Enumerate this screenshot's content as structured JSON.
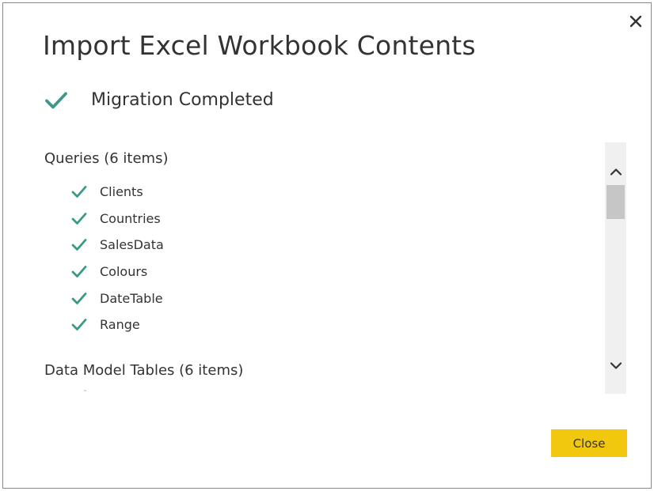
{
  "dialog": {
    "title": "Import Excel Workbook Contents",
    "close_icon": "close-icon",
    "status": {
      "icon": "check-icon",
      "text": "Migration Completed"
    }
  },
  "queries": {
    "heading": "Queries (6 items)",
    "items": [
      {
        "label": "Clients",
        "icon": "check-icon"
      },
      {
        "label": "Countries",
        "icon": "check-icon"
      },
      {
        "label": "SalesData",
        "icon": "check-icon"
      },
      {
        "label": "Colours",
        "icon": "check-icon"
      },
      {
        "label": "DateTable",
        "icon": "check-icon"
      },
      {
        "label": "Range",
        "icon": "check-icon"
      }
    ]
  },
  "data_model": {
    "heading": "Data Model Tables (6 items)"
  },
  "scrollbar": {
    "up_icon": "chevron-up-icon",
    "down_icon": "chevron-down-icon"
  },
  "footer": {
    "close_label": "Close"
  },
  "colors": {
    "check": "#3a9a86",
    "accent_button": "#f2c80f",
    "text": "#333333",
    "scroll_track": "#f0f0f0",
    "scroll_thumb": "#c6c6c6"
  }
}
